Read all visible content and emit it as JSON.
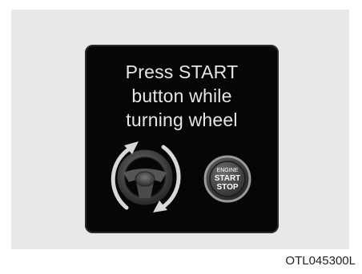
{
  "message": {
    "line1": "Press START",
    "line2": "button while",
    "line3": "turning wheel"
  },
  "button": {
    "line1": "ENGINE",
    "line2": "START",
    "line3": "STOP"
  },
  "figure_code": "OTL045300L",
  "icons": [
    "steering-wheel-icon",
    "rotate-arrow-icon",
    "engine-start-stop-button-icon"
  ],
  "colors": {
    "background": "#ffffff",
    "panel": "#e8e8e9",
    "display": "#060606",
    "text": "#e6e6e6"
  }
}
